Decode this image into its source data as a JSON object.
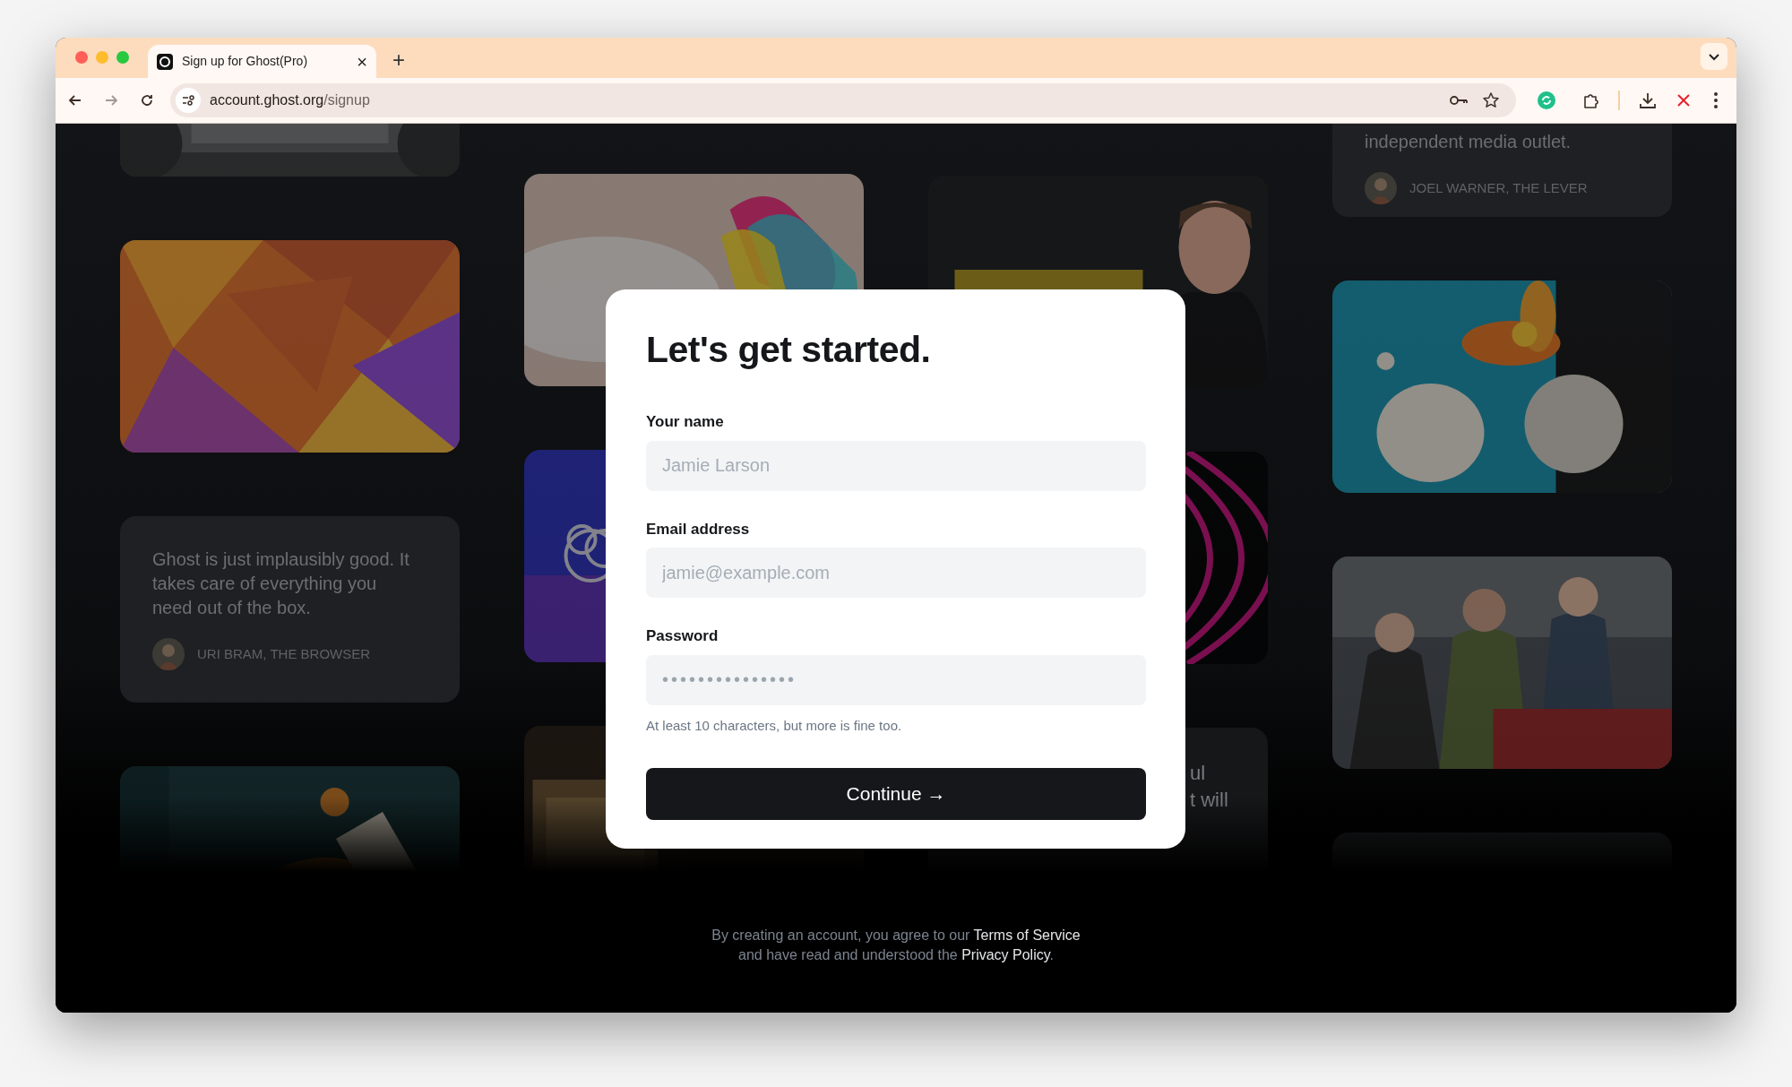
{
  "browser": {
    "tab": {
      "title": "Sign up for Ghost(Pro)",
      "close": "×",
      "selected": true
    },
    "new_tab": "+",
    "url_host": "account.ghost.org",
    "url_path": "/signup"
  },
  "background": {
    "columns": [
      {
        "cards": [
          {
            "kind": "picture"
          },
          {
            "kind": "picture"
          },
          {
            "kind": "quote",
            "quote": "Ghost is just implausibly good. It takes care of everything you need out of the box.",
            "author": "URI BRAM, THE BROWSER"
          },
          {
            "kind": "picture"
          }
        ]
      },
      {
        "cards": [
          {
            "kind": "picture"
          },
          {
            "kind": "picture"
          },
          {
            "kind": "picture"
          }
        ]
      },
      {
        "cards": [
          {
            "kind": "picture"
          },
          {
            "kind": "picture"
          },
          {
            "kind": "fragment",
            "lines": [
              "ul",
              "t will"
            ]
          }
        ]
      },
      {
        "cards": [
          {
            "kind": "quote",
            "quote": "independent media outlet.",
            "author": "JOEL WARNER, THE LEVER"
          },
          {
            "kind": "picture"
          },
          {
            "kind": "picture"
          },
          {
            "kind": "picture"
          }
        ]
      }
    ]
  },
  "form": {
    "title": "Let's get started.",
    "fields": [
      {
        "label": "Your name",
        "placeholder": "Jamie Larson"
      },
      {
        "label": "Email address",
        "placeholder": "jamie@example.com"
      },
      {
        "label": "Password",
        "value": "•••••••••••••••",
        "hint": "At least 10 characters, but more is fine too."
      }
    ],
    "button": "Continue →"
  },
  "footer": {
    "text_1": "By creating an account, you agree to our",
    "link_1": "Terms of Service",
    "text_2": "and have read and understood the",
    "link_2": "Privacy Policy",
    "end": "."
  }
}
